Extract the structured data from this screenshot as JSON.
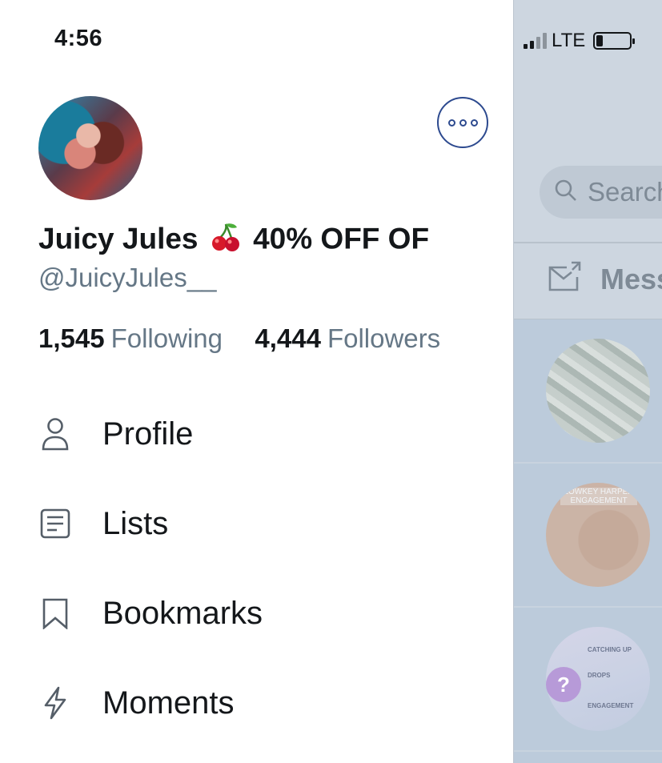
{
  "status_bar": {
    "time": "4:56",
    "carrier": "LTE"
  },
  "profile": {
    "display_name_part1": "Juicy Jules",
    "display_name_emoji": "cherry-emoji",
    "display_name_part2": "40% OFF OF",
    "handle": "@JuicyJules__",
    "following_count": "1,545",
    "following_label": "Following",
    "followers_count": "4,444",
    "followers_label": "Followers"
  },
  "menu": {
    "items": [
      {
        "label": "Profile",
        "icon": "person-icon"
      },
      {
        "label": "Lists",
        "icon": "list-icon"
      },
      {
        "label": "Bookmarks",
        "icon": "bookmark-icon"
      },
      {
        "label": "Moments",
        "icon": "lightning-icon"
      }
    ]
  },
  "right_pane": {
    "search_placeholder": "Search",
    "messages_label": "Mess",
    "dm_previews": [
      {
        "kind": "money-image"
      },
      {
        "kind": "graphic",
        "caption": "LOWKEY HARPER ENGAGEMENT"
      },
      {
        "kind": "info-card",
        "lines": [
          "CATCHING UP",
          "DROPS",
          "ENGAGEMENT"
        ]
      }
    ]
  },
  "colors": {
    "accent": "#2d4a8f",
    "secondary_text": "#657786",
    "dim_overlay": "#cdd6e0"
  }
}
